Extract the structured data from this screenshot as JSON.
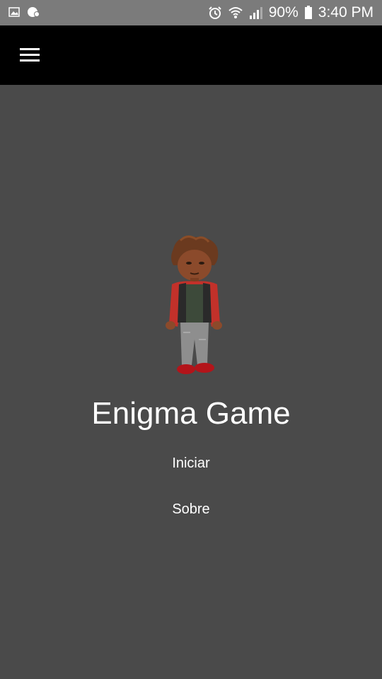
{
  "status_bar": {
    "battery": "90%",
    "time": "3:40 PM",
    "left_icons": [
      "image-icon",
      "notification-icon"
    ],
    "right_icons": [
      "alarm-icon",
      "wifi-icon",
      "signal-icon",
      "battery-icon"
    ]
  },
  "app_bar": {
    "menu_icon": "hamburger-menu-icon"
  },
  "main": {
    "title": "Enigma Game",
    "menu": [
      {
        "label": "Iniciar"
      },
      {
        "label": "Sobre"
      }
    ]
  },
  "colors": {
    "status_bar_bg": "#7b7b7b",
    "app_bar_bg": "#000000",
    "content_bg": "#4a4a4a",
    "text": "#ffffff"
  }
}
